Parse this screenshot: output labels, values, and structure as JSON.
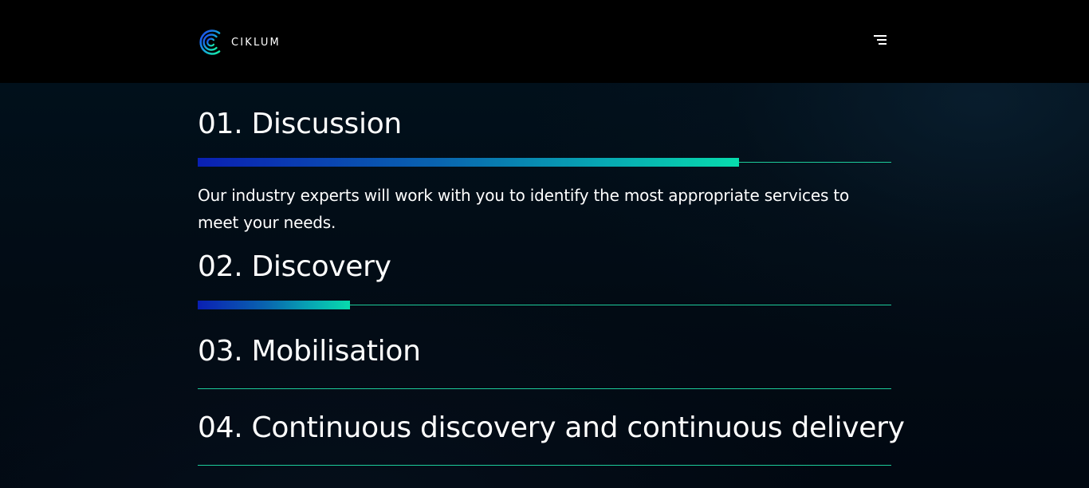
{
  "header": {
    "brand": "CIKLUM",
    "logo_icon": "ciklum-logo-icon",
    "menu_icon": "hamburger-menu-icon"
  },
  "colors": {
    "background": "#000000",
    "accent_start": "#0b22c4",
    "accent_end": "#08f2bd",
    "track": "#1fe0a8",
    "text": "#ffffff"
  },
  "steps": [
    {
      "title": "01. Discussion",
      "progress": 0.78,
      "description": "Our industry experts will work with you to identify the most appropriate services to meet your needs."
    },
    {
      "title": "02. Discovery",
      "progress": 0.22,
      "description": ""
    },
    {
      "title": "03. Mobilisation",
      "progress": 0,
      "description": ""
    },
    {
      "title": "04. Continuous discovery and continuous delivery",
      "progress": 0,
      "description": ""
    }
  ]
}
